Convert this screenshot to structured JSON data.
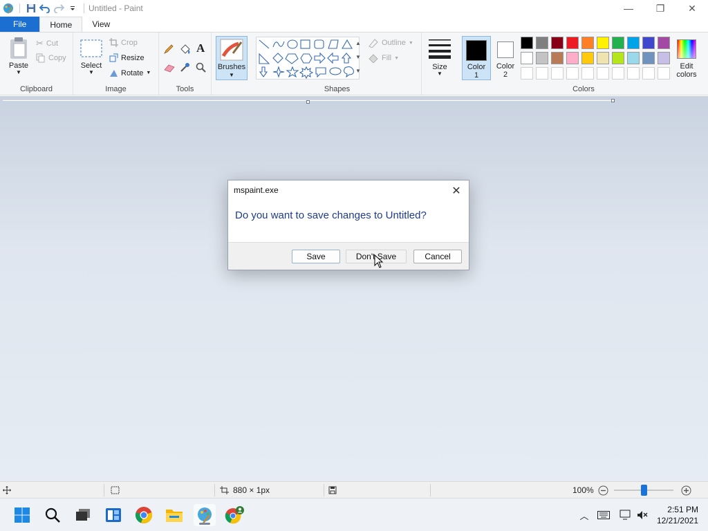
{
  "window": {
    "title": "Untitled - Paint",
    "minimize_glyph": "—",
    "maximize_glyph": "❐",
    "close_glyph": "✕"
  },
  "tabs": [
    {
      "label": "File"
    },
    {
      "label": "Home"
    },
    {
      "label": "View"
    }
  ],
  "ribbon": {
    "clipboard": {
      "group_label": "Clipboard",
      "paste": "Paste",
      "cut": "Cut",
      "copy": "Copy"
    },
    "image": {
      "group_label": "Image",
      "select": "Select",
      "crop": "Crop",
      "resize": "Resize",
      "rotate": "Rotate"
    },
    "tools": {
      "group_label": "Tools"
    },
    "brushes": {
      "label": "Brushes"
    },
    "shapes": {
      "group_label": "Shapes",
      "outline": "Outline",
      "fill": "Fill"
    },
    "size": {
      "label": "Size"
    },
    "colors": {
      "group_label": "Colors",
      "color1_line1": "Color",
      "color1_line2": "1",
      "color2_line1": "Color",
      "color2_line2": "2",
      "edit_line1": "Edit",
      "edit_line2": "colors",
      "color1_value": "#000000",
      "color2_value": "#ffffff",
      "palette_row1": [
        "#000000",
        "#7f7f7f",
        "#880015",
        "#ed1c24",
        "#ff7f27",
        "#fff200",
        "#22b14c",
        "#00a2e8",
        "#3f48cc",
        "#a349a4"
      ],
      "palette_row2": [
        "#ffffff",
        "#c3c3c3",
        "#b97a57",
        "#ffaec9",
        "#ffc90e",
        "#efe4b0",
        "#b5e61d",
        "#99d9ea",
        "#7092be",
        "#c8bfe7"
      ],
      "palette_row3": [
        "#ffffff",
        "#ffffff",
        "#ffffff",
        "#ffffff",
        "#ffffff",
        "#ffffff",
        "#ffffff",
        "#ffffff",
        "#ffffff",
        "#ffffff"
      ]
    }
  },
  "dialog": {
    "title": "mspaint.exe",
    "message": "Do you want to save changes to Untitled?",
    "save": "Save",
    "dont_save": "Don't Save",
    "cancel": "Cancel"
  },
  "status": {
    "dimensions": "880 × 1px",
    "zoom": "100%",
    "zoom_level_percent": 100
  },
  "taskbar": {
    "time": "2:51 PM",
    "date": "12/21/2021"
  }
}
